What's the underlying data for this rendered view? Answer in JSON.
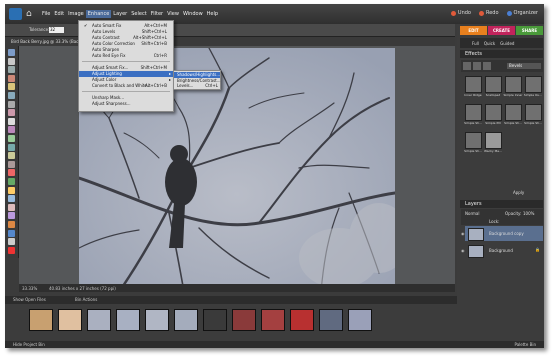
{
  "menubar": {
    "items": [
      "File",
      "Edit",
      "Image",
      "Enhance",
      "Layer",
      "Select",
      "Filter",
      "View",
      "Window",
      "Help"
    ],
    "active_index": 3,
    "right": [
      {
        "label": "Undo",
        "color": "#e05a3a"
      },
      {
        "label": "Redo",
        "color": "#e05a3a"
      },
      {
        "label": "Organizer",
        "color": "#4a7fd4"
      }
    ]
  },
  "options": {
    "tolerance_label": "Tolerance:",
    "tolerance_value": "32"
  },
  "document": {
    "tab_title": "Bird Back Berry.jpg @ 33.3% (Backgro..."
  },
  "enhance_menu": [
    {
      "label": "Auto Smart Fix",
      "shortcut": "Alt+Ctrl+M"
    },
    {
      "label": "Auto Levels",
      "shortcut": "Shift+Ctrl+L"
    },
    {
      "label": "Auto Contrast",
      "shortcut": "Alt+Shift+Ctrl+L"
    },
    {
      "label": "Auto Color Correction",
      "shortcut": "Shift+Ctrl+B"
    },
    {
      "label": "Auto Sharpen",
      "shortcut": ""
    },
    {
      "label": "Auto Red Eye Fix",
      "shortcut": "Ctrl+R"
    },
    {
      "label": "Adjust Smart Fix...",
      "shortcut": "Shift+Ctrl+M"
    },
    {
      "label": "Adjust Lighting",
      "shortcut": ""
    },
    {
      "label": "Adjust Color",
      "shortcut": ""
    },
    {
      "label": "Convert to Black and White...",
      "shortcut": "Alt+Ctrl+B"
    },
    {
      "label": "Unsharp Mask...",
      "shortcut": ""
    },
    {
      "label": "Adjust Sharpness...",
      "shortcut": ""
    }
  ],
  "highlighted_item": "Adjust Lighting",
  "lighting_submenu": [
    {
      "label": "Shadows/Highlights...",
      "shortcut": ""
    },
    {
      "label": "Brightness/Contrast...",
      "shortcut": ""
    },
    {
      "label": "Levels...",
      "shortcut": "Ctrl+L"
    }
  ],
  "panel": {
    "mode_tabs": [
      {
        "label": "EDIT",
        "color": "#e8801e"
      },
      {
        "label": "CREATE",
        "color": "#c2245c"
      },
      {
        "label": "SHARE",
        "color": "#4a9a3a"
      }
    ],
    "sub_tabs": [
      "Full",
      "Quick",
      "Guided"
    ],
    "effects_title": "Effects",
    "effects_filter": "Bevels",
    "effects": [
      "Inner Ridge",
      "Scalloped",
      "Simple Inner",
      "Simple Ou...",
      "Simple Sh...",
      "Simple Pill",
      "Simple Sh...",
      "Simple Sh...",
      "Simple Sh...",
      "Wacky Me..."
    ],
    "apply_label": "Apply",
    "layers_title": "Layers",
    "blend_mode": "Normal",
    "opacity_label": "Opacity:",
    "opacity_value": "100%",
    "lock_label": "Lock:",
    "layers": [
      "Background copy",
      "Background"
    ]
  },
  "status": {
    "zoom": "33.33%",
    "info": "40.83 inches x 27 inches (72 ppi)"
  },
  "bin": {
    "title": "Show Open Files",
    "actions": "Bin Actions",
    "hide_label": "Hide Project Bin",
    "palette_label": "Palette Bin"
  }
}
